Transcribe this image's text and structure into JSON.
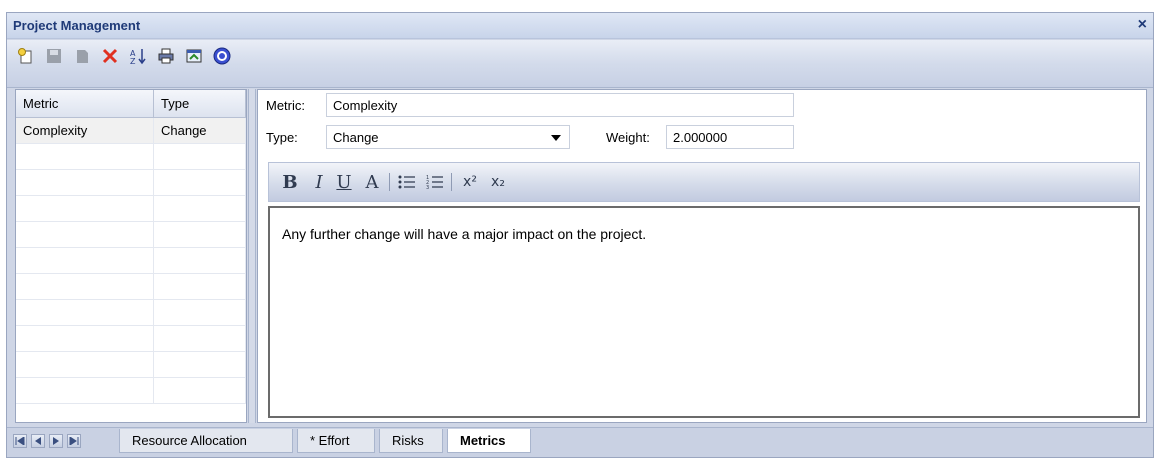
{
  "window": {
    "title": "Project Management",
    "close_label": "×"
  },
  "toolbar": {
    "icons": [
      "new-icon",
      "save-icon",
      "copy-icon",
      "delete-icon",
      "sort-icon",
      "print-icon",
      "options-icon",
      "help-icon"
    ]
  },
  "list": {
    "headers": [
      "Metric",
      "Type"
    ],
    "rows": [
      {
        "metric": "Complexity",
        "type": "Change"
      }
    ]
  },
  "form": {
    "metric_label": "Metric:",
    "metric_value": "Complexity",
    "type_label": "Type:",
    "type_value": "Change",
    "weight_label": "Weight:",
    "weight_value": "2.000000"
  },
  "format_toolbar": {
    "bold": "B",
    "italic": "I",
    "underline": "U",
    "font_color": "A",
    "superscript": "x²",
    "subscript": "x₂"
  },
  "editor": {
    "text": "Any further change will have a major impact on the project."
  },
  "tabs": {
    "items": [
      "Resource Allocation",
      "* Effort",
      "Risks",
      "Metrics"
    ],
    "active": "Metrics"
  },
  "colors": {
    "title": "#1f3a78",
    "delete": "#e03020",
    "help": "#3a4fd0"
  }
}
